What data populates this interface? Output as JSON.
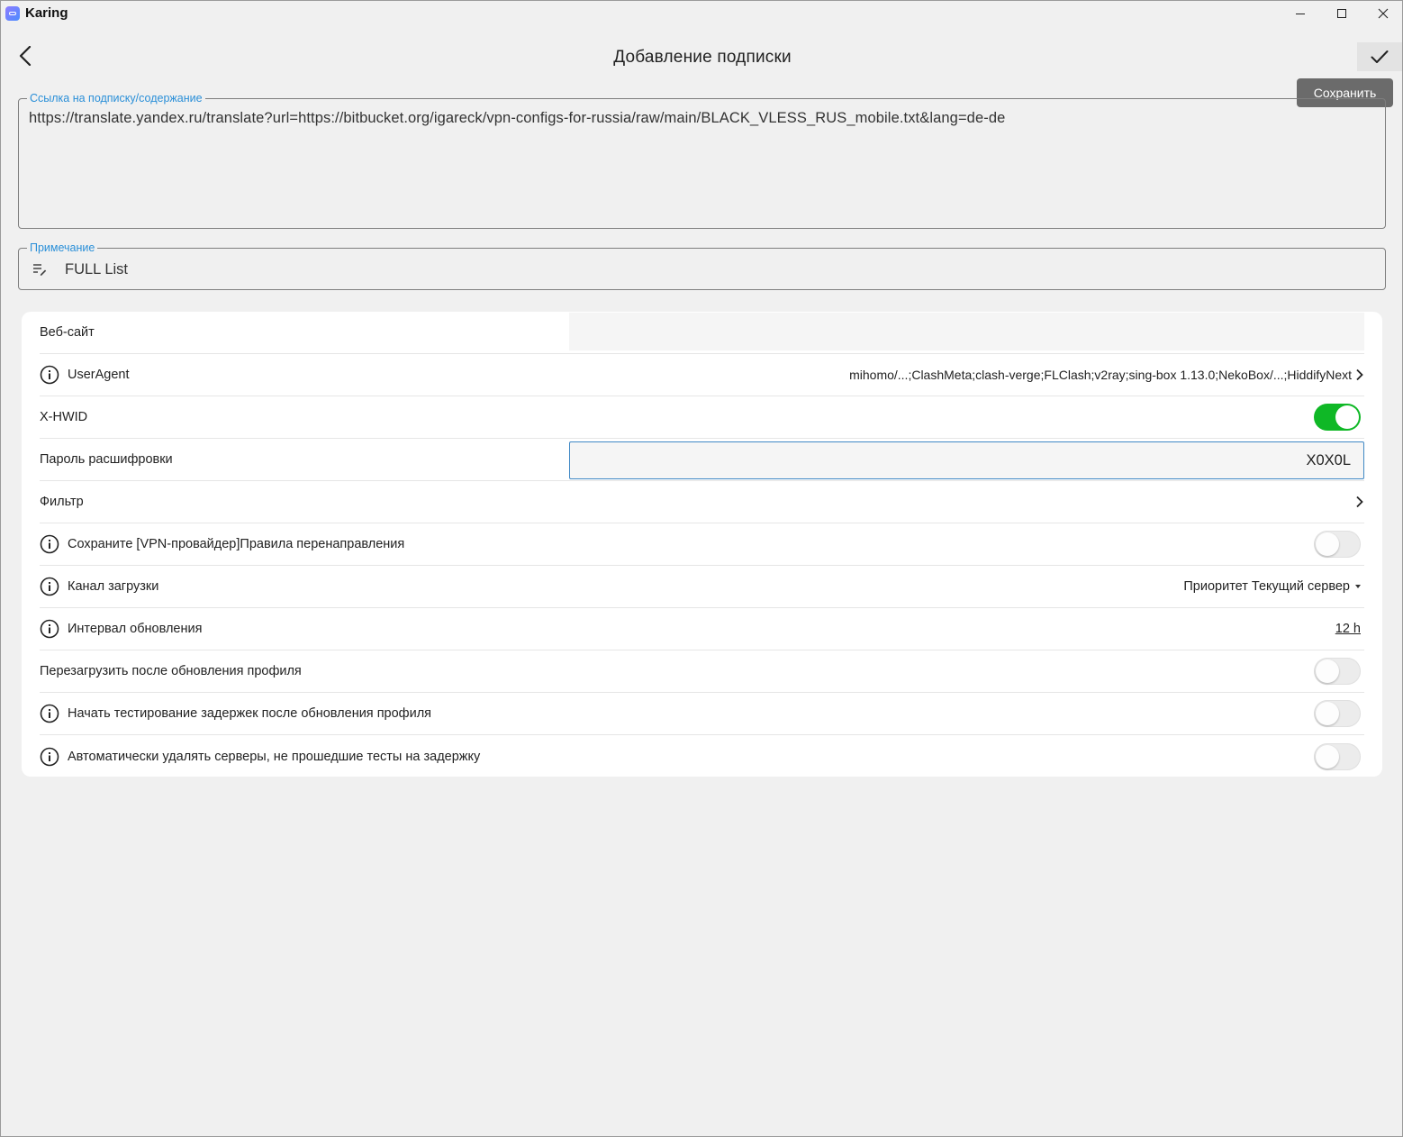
{
  "window": {
    "title": "Karing",
    "icons": {
      "app": "karing-app-icon",
      "minimize": "minimize-icon",
      "maximize": "maximize-icon",
      "close": "close-icon"
    }
  },
  "appbar": {
    "title": "Добавление подписки",
    "back_icon": "chevron-left-icon",
    "save_icon": "check-icon",
    "save_tooltip": "Сохранить"
  },
  "url_field": {
    "label": "Ссылка на подписку/содержание",
    "value": "https://translate.yandex.ru/translate?url=https://bitbucket.org/igareck/vpn-configs-for-russia/raw/main/BLACK_VLESS_RUS_mobile.txt&lang=de-de"
  },
  "note_field": {
    "label": "Примечание",
    "value": "FULL List",
    "icon": "edit-note-icon"
  },
  "settings": {
    "website": {
      "label": "Веб-сайт",
      "value": ""
    },
    "user_agent": {
      "label": "UserAgent",
      "value": "mihomo/...;ClashMeta;clash-verge;FLClash;v2ray;sing-box 1.13.0;NekoBox/...;HiddifyNext"
    },
    "x_hwid": {
      "label": "X-HWID",
      "enabled": true
    },
    "decrypt_password": {
      "label": "Пароль расшифровки",
      "value": "X0X0L"
    },
    "filter": {
      "label": "Фильтр"
    },
    "keep_vpn_rules": {
      "label": "Сохраните [VPN-провайдер]Правила перенаправления",
      "enabled": false
    },
    "download_channel": {
      "label": "Канал загрузки",
      "value": "Приоритет Текущий сервер"
    },
    "update_interval": {
      "label": "Интервал обновления",
      "value": "12 h"
    },
    "reload_after_update": {
      "label": "Перезагрузить после обновления профиля",
      "enabled": false
    },
    "latency_test_after_update": {
      "label": "Начать тестирование задержек после обновления профиля",
      "enabled": false
    },
    "auto_remove_failed": {
      "label": "Автоматически удалять серверы, не прошедшие тесты на задержку",
      "enabled": false
    }
  },
  "colors": {
    "accent": "#2a8fd8",
    "toggle_on": "#0fb826",
    "background": "#f0f0f0",
    "card": "#ffffff"
  }
}
